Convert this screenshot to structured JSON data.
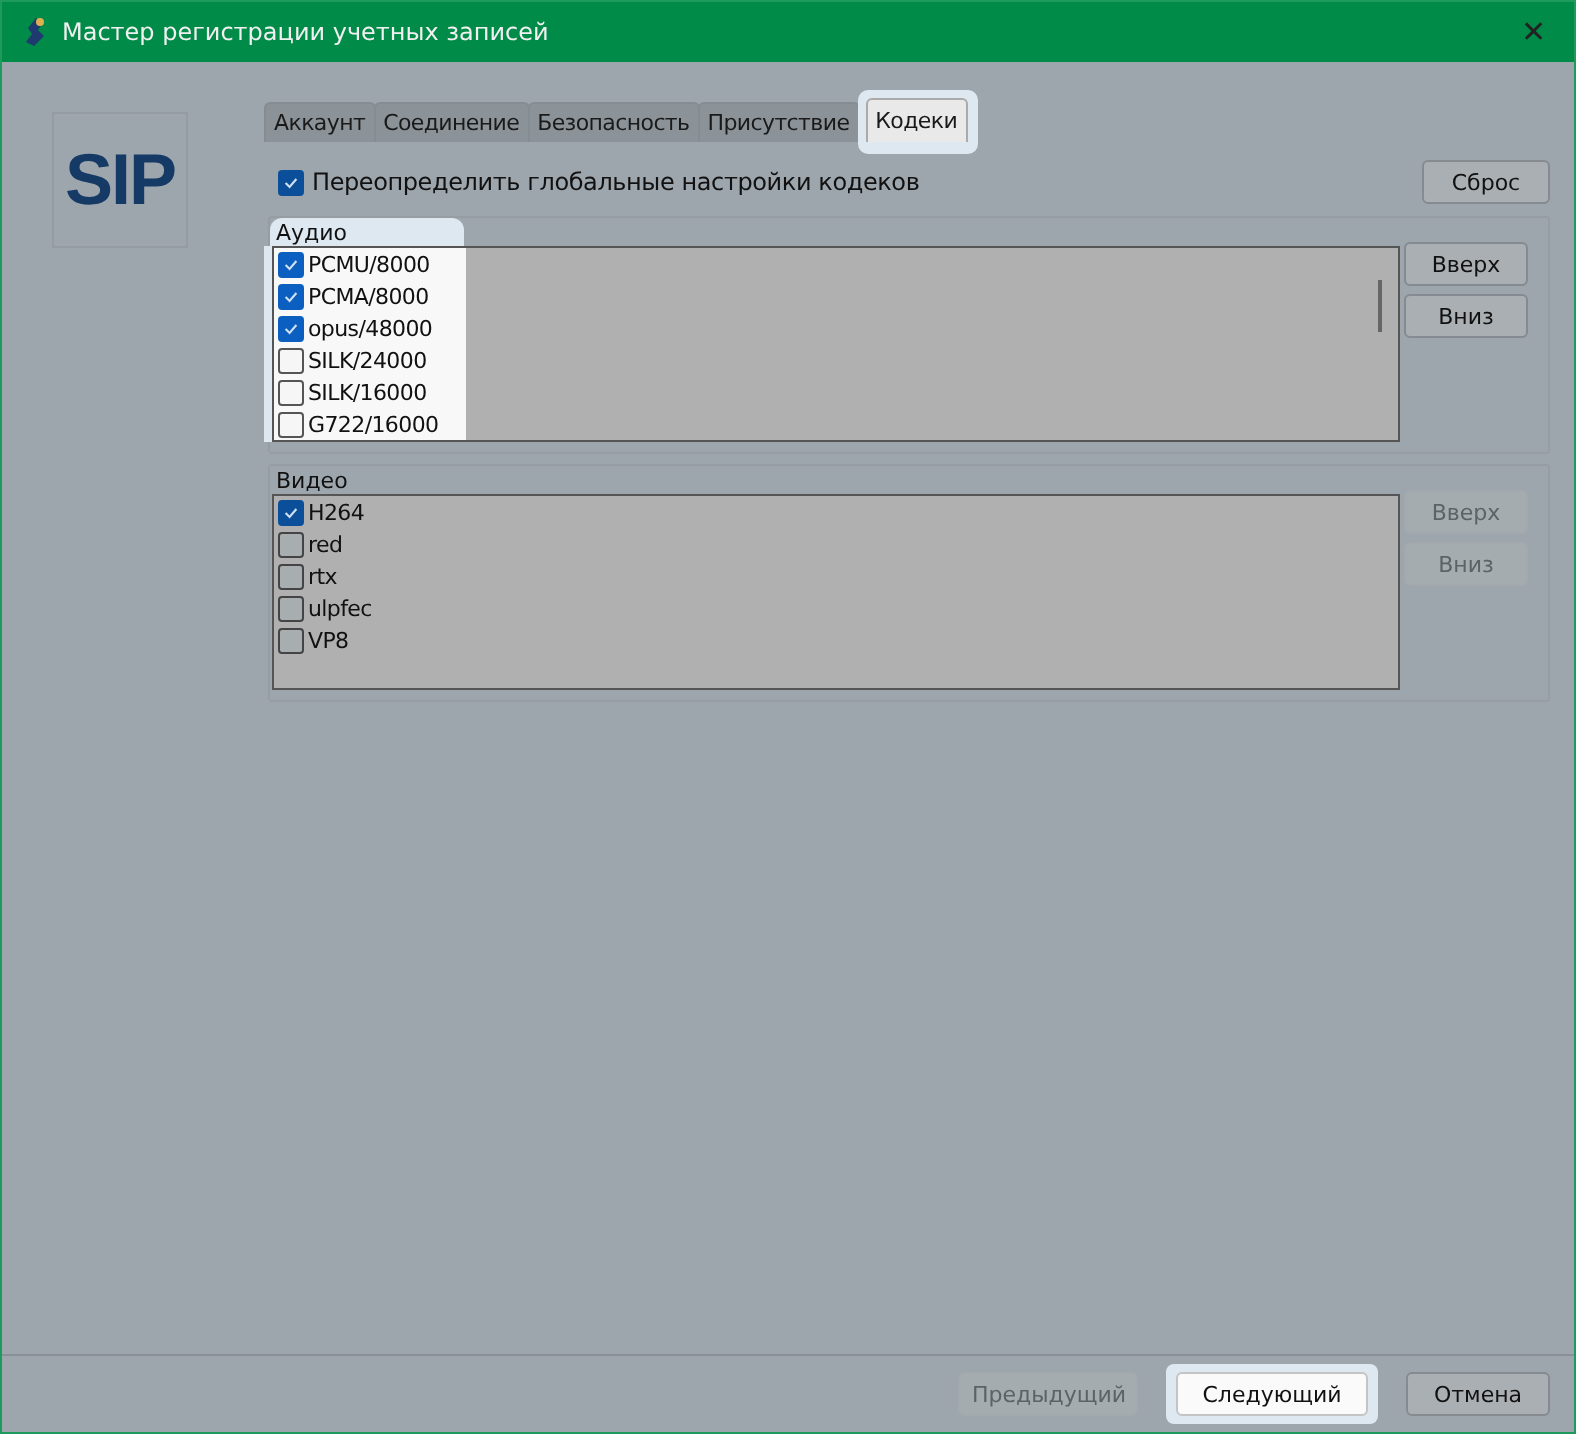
{
  "window": {
    "title": "Мастер регистрации учетных записей",
    "close": "✕"
  },
  "logo": "SIP",
  "tabs": [
    {
      "label": "Аккаунт",
      "selected": false
    },
    {
      "label": "Соединение",
      "selected": false
    },
    {
      "label": "Безопасность",
      "selected": false
    },
    {
      "label": "Присутствие",
      "selected": false
    },
    {
      "label": "Кодеки",
      "selected": true
    }
  ],
  "override": {
    "label": "Переопределить глобальные настройки кодеков",
    "checked": true
  },
  "reset_button": "Сброс",
  "groups": [
    {
      "title": "Аудио",
      "highlighted": true,
      "up": "Вверх",
      "down": "Вниз",
      "buttons_disabled": false,
      "scrollbar": true,
      "codecs": [
        {
          "name": "PCMU/8000",
          "checked": true
        },
        {
          "name": "PCMA/8000",
          "checked": true
        },
        {
          "name": "opus/48000",
          "checked": true
        },
        {
          "name": "SILK/24000",
          "checked": false
        },
        {
          "name": "SILK/16000",
          "checked": false
        },
        {
          "name": "G722/16000",
          "checked": false
        }
      ]
    },
    {
      "title": "Видео",
      "highlighted": false,
      "up": "Вверх",
      "down": "Вниз",
      "buttons_disabled": true,
      "codecs": [
        {
          "name": "H264",
          "checked": true
        },
        {
          "name": "red",
          "checked": false
        },
        {
          "name": "rtx",
          "checked": false
        },
        {
          "name": "ulpfec",
          "checked": false
        },
        {
          "name": "VP8",
          "checked": false
        }
      ]
    }
  ],
  "footer": [
    {
      "label": "Предыдущий",
      "disabled": true,
      "highlighted": false
    },
    {
      "label": "Следующий",
      "disabled": false,
      "highlighted": true
    },
    {
      "label": "Отмена",
      "disabled": false,
      "highlighted": false
    }
  ]
}
